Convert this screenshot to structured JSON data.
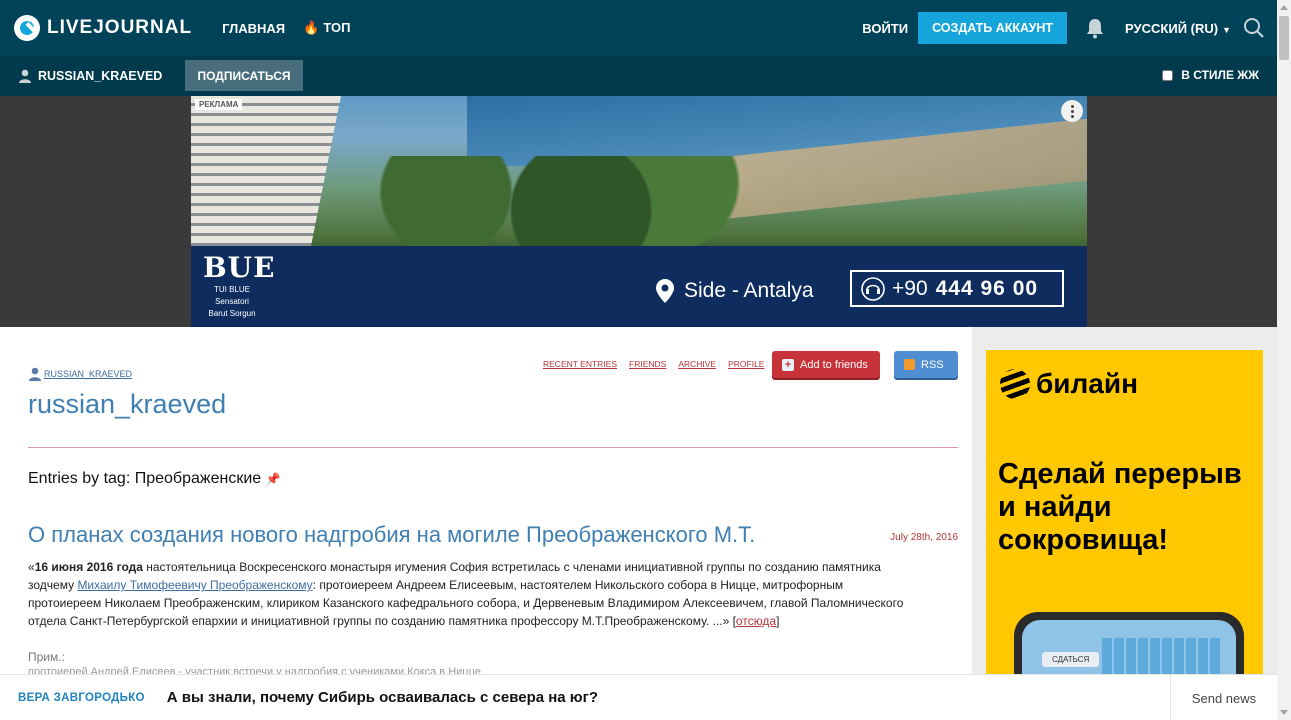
{
  "header": {
    "logo_text": "LIVEJOURNAL",
    "nav": [
      {
        "label": "ГЛАВНАЯ"
      },
      {
        "label": "ТОП",
        "icon": "flame-icon"
      }
    ],
    "login_label": "ВОЙТИ",
    "create_account_label": "СОЗДАТЬ АККАУНТ",
    "language_label": "РУССКИЙ (RU)",
    "accent_color": "#15a5da",
    "background_color": "#004359"
  },
  "subbar": {
    "username": "RUSSIAN_KRAEVED",
    "subscribe_label": "ПОДПИСАТЬСЯ",
    "style_toggle_label": "В СТИЛЕ ЖЖ",
    "style_toggle_checked": false
  },
  "banner_ad": {
    "label": "РЕКЛАМА",
    "brand_logo": "BUE",
    "brand_line1": "TUI BLUE",
    "brand_line2": "Sensatori",
    "brand_line3": "Barut Sorgun",
    "location": "Side - Antalya",
    "phone_prefix": "+90",
    "phone_number": "444 96 00"
  },
  "journal": {
    "owner": "RUSSIAN_KRAEVED",
    "title": "russian_kraeved",
    "links": [
      "RECENT ENTRIES",
      "FRIENDS",
      "ARCHIVE",
      "PROFILE"
    ],
    "add_friends_label": "Add to friends",
    "rss_label": "RSS",
    "tag_heading": "Entries by tag: Преображенские"
  },
  "post": {
    "title": "О планах создания нового надгробия на могиле Преображенского М.Т.",
    "date": "July 28th, 2016",
    "body_open": "«",
    "body_bold": "16 июня 2016 года",
    "body_part1": " настоятельница Воскресенского монастыря игумения София встретилась с членами инициативной группы по созданию памятника зодчему ",
    "body_link": "Михаилу Тимофеевичу Преображенскому",
    "body_part2": ": протоиереем Андреем Елисеевым, настоятелем Никольского собора в Ницце, митрофорным протоиереем Николаем Преображенским, клириком Казанского кафедрального собора, и Дервеневым Владимиром Алексеевичем, главой Паломнического отдела Санкт-Петербургской епархии и инициативной группы по созданию памятника профессору М.Т.Преображенскому. ...» [",
    "more_link": "отсюда",
    "body_close": "]",
    "note_label": "Прим.:",
    "note_text": "протоиерей Андрей Елисеев - участник встречи у надгробия с учениками Кокса в Ницце"
  },
  "sidebar_ad": {
    "brand": "билайн",
    "headline": "Сделай перерыв и найди сокровища!",
    "game_button": "СДАТЬСЯ"
  },
  "news_bar": {
    "author": "ВЕРА ЗАВГОРОДЬКО",
    "title": "А вы знали, почему Сибирь осваивалась с севера на юг?",
    "send_label": "Send news"
  }
}
